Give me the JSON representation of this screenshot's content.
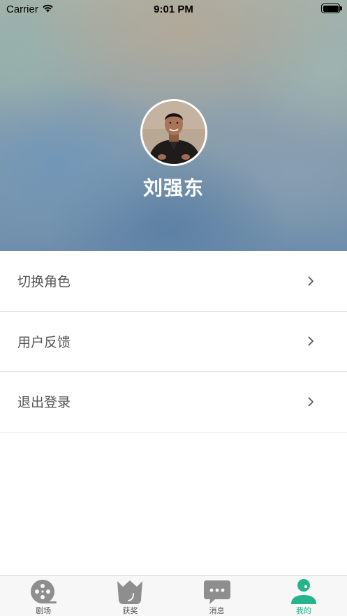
{
  "status_bar": {
    "carrier": "Carrier",
    "time": "9:01 PM"
  },
  "profile": {
    "name": "刘强东"
  },
  "menu": {
    "items": [
      {
        "label": "切换角色",
        "icon": "chevron-right-icon"
      },
      {
        "label": "用户反馈",
        "icon": "chevron-right-icon"
      },
      {
        "label": "退出登录",
        "icon": "chevron-right-icon"
      }
    ]
  },
  "tab_bar": {
    "tabs": [
      {
        "label": "剧场",
        "icon": "film-reel-icon",
        "active": false
      },
      {
        "label": "获奖",
        "icon": "crown-icon",
        "active": false
      },
      {
        "label": "消息",
        "icon": "message-bubble-icon",
        "active": false
      },
      {
        "label": "我的",
        "icon": "person-icon",
        "active": true
      }
    ],
    "inactive_color": "#8e8e8e",
    "active_color": "#25b48c"
  }
}
